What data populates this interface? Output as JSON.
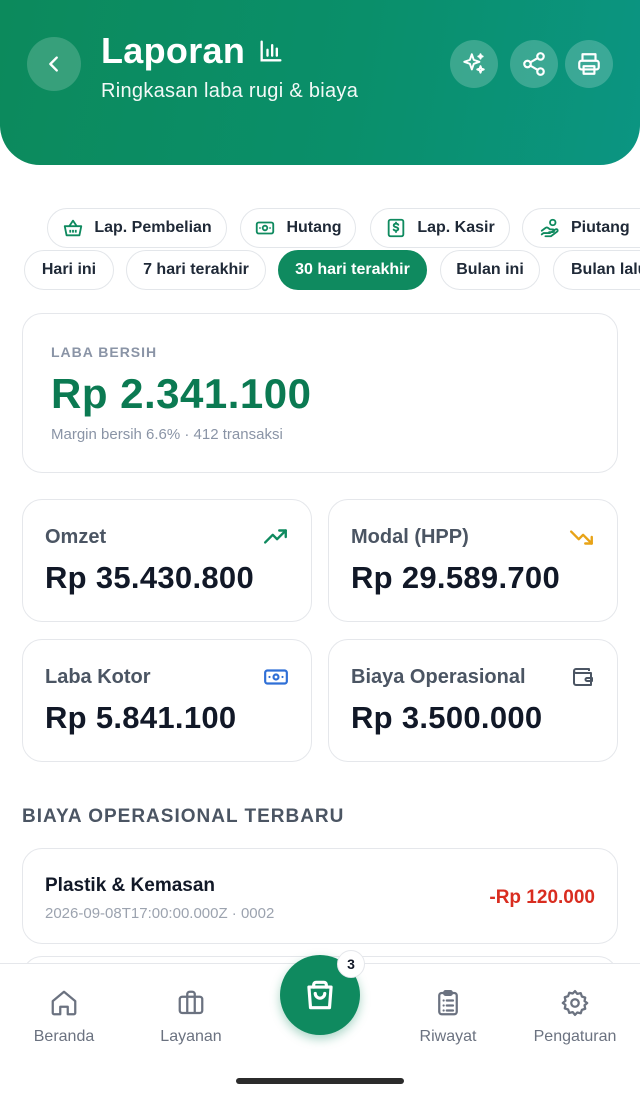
{
  "header": {
    "title": "Laporan",
    "subtitle": "Ringkasan laba rugi & biaya",
    "back_icon": "chevron-left-icon",
    "title_icon": "bar-chart-icon",
    "actions": [
      "sparkles-icon",
      "share-icon",
      "printer-icon"
    ]
  },
  "report_tabs": [
    {
      "label": "Lap. Pembelian",
      "icon": "basket-icon"
    },
    {
      "label": "Hutang",
      "icon": "banknote-icon"
    },
    {
      "label": "Lap. Kasir",
      "icon": "receipt-dollar-icon"
    },
    {
      "label": "Piutang",
      "icon": "hand-coins-icon"
    }
  ],
  "period_filters": {
    "items": [
      "Hari ini",
      "7 hari terakhir",
      "30 hari terakhir",
      "Bulan ini",
      "Bulan lalu"
    ],
    "selected": "30 hari terakhir"
  },
  "net_profit": {
    "label": "LABA BERSIH",
    "value": "Rp 2.341.100",
    "subtitle": "Margin bersih 6.6% · 412 transaksi"
  },
  "stats": [
    {
      "label": "Omzet",
      "value": "Rp 35.430.800",
      "icon": "trending-up-icon",
      "icon_color": "#0f8a5f"
    },
    {
      "label": "Modal (HPP)",
      "value": "Rp 29.589.700",
      "icon": "trending-down-icon",
      "icon_color": "#e8a317"
    },
    {
      "label": "Laba Kotor",
      "value": "Rp 5.841.100",
      "icon": "banknote-icon",
      "icon_color": "#2f6fd6"
    },
    {
      "label": "Biaya Operasional",
      "value": "Rp 3.500.000",
      "icon": "wallet-icon",
      "icon_color": "#4b5563"
    }
  ],
  "expenses": {
    "section_title": "BIAYA OPERASIONAL TERBARU",
    "items": [
      {
        "name": "Plastik & Kemasan",
        "meta": "2026-09-08T17:00:00.000Z · 0002",
        "amount": "-Rp 120.000"
      }
    ]
  },
  "bottom_nav": {
    "items": [
      {
        "label": "Beranda",
        "icon": "home-icon"
      },
      {
        "label": "Layanan",
        "icon": "briefcase-icon"
      },
      {
        "label": "Riwayat",
        "icon": "clipboard-list-icon"
      },
      {
        "label": "Pengaturan",
        "icon": "gear-icon"
      }
    ],
    "cart_badge": "3",
    "cart_icon": "shopping-bag-icon"
  },
  "colors": {
    "primary": "#0f8a5f",
    "net_profit": "#0b7a52",
    "expense_amount": "#d92d20"
  }
}
